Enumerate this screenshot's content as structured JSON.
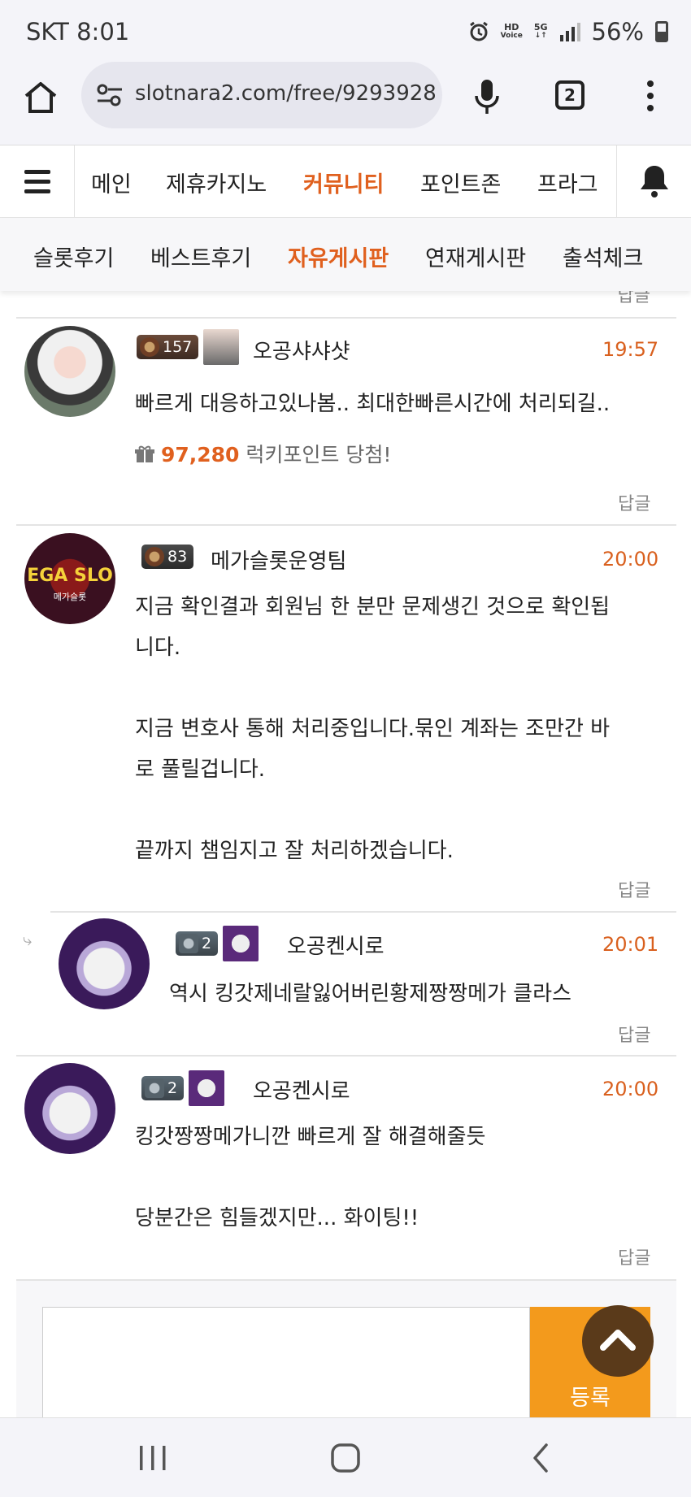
{
  "status": {
    "carrier_time": "SKT 8:01",
    "battery": "56%",
    "hd_top": "HD",
    "hd_bottom": "Voice",
    "net_top": "5G",
    "net_bottom": "↓↑"
  },
  "browser": {
    "url": "slotnara2.com/free/9293928",
    "tab_count": "2"
  },
  "nav": {
    "items": [
      "메인",
      "제휴카지노",
      "커뮤니티",
      "포인트존",
      "프라그"
    ],
    "active": "커뮤니티"
  },
  "subnav": {
    "items": [
      "슬롯후기",
      "베스트후기",
      "자유게시판",
      "연재게시판",
      "출석체크"
    ],
    "active": "자유게시판"
  },
  "reply_label": "답글",
  "comments": [
    {
      "level": "157",
      "nick": "오공샤샤샷",
      "time": "19:57",
      "lines": [
        "빠르게 대응하고있나봄..  최대한빠른시간에 처리되길.."
      ],
      "lucky_points": "97,280",
      "lucky_text": "럭키포인트 당첨!"
    },
    {
      "level": "83",
      "nick": "메가슬롯운영팀",
      "time": "20:00",
      "lines": [
        "지금 확인결과 회원님 한 분만 문제생긴 것으로 확인됩",
        "니다.",
        "",
        "지금 변호사 통해 처리중입니다.묶인 계좌는 조만간 바",
        "로 풀릴겁니다.",
        "",
        "끝까지 챔임지고 잘 처리하겠습니다."
      ],
      "avatar_text": "EGA SLO",
      "avatar_sub": "메가슬롯"
    },
    {
      "level": "2",
      "nick": "오공켄시로",
      "time": "20:01",
      "lines": [
        "역시 킹갓제네랄잃어버린황제짱짱메가 클라스"
      ]
    },
    {
      "level": "2",
      "nick": "오공켄시로",
      "time": "20:00",
      "lines": [
        "킹갓짱짱메가니깐 빠르게 잘 해결해줄듯",
        "",
        "당분간은 힘들겠지만... 화이팅!!"
      ]
    }
  ],
  "submit_label": "등록",
  "colors": {
    "accent": "#e0601e",
    "submit": "#f39a1c",
    "scroll_top": "#5a3a1a"
  }
}
